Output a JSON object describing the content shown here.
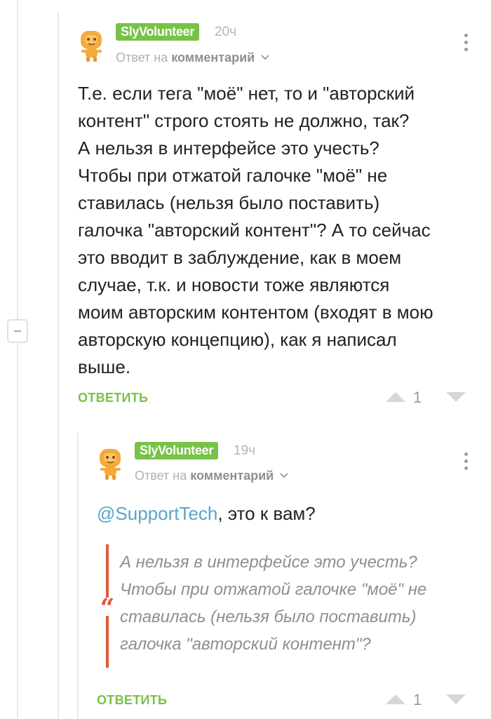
{
  "comments": [
    {
      "username": "SlyVolunteer",
      "time": "20ч",
      "reply_prefix": "Ответ на",
      "reply_target": "комментарий",
      "text_lines": [
        "Т.е. если тега \"моё\" нет, то и \"авторский",
        "контент\" строго стоять не должно, так?",
        "А нельзя в интерфейсе это учесть?",
        "Чтобы при отжатой галочке \"моё\" не",
        "ставилась (нельзя было поставить)",
        "галочка \"авторский контент\"? А то сейчас",
        "это вводит в заблуждение, как в моем",
        "случае, т.к. и новости тоже являются",
        "моим авторским контентом (входят в мою",
        "авторскую концепцию), как я написал",
        "выше."
      ],
      "reply_label": "ОТВЕТИТЬ",
      "score": "1"
    },
    {
      "username": "SlyVolunteer",
      "time": "19ч",
      "reply_prefix": "Ответ на",
      "reply_target": "комментарий",
      "mention": "@SupportTech",
      "text_after_mention": ", это к вам?",
      "quote_lines": [
        "А нельзя в интерфейсе это учесть?",
        "Чтобы при отжатой галочке \"моё\" не",
        "ставилась (нельзя было поставить)",
        "галочка \"авторский контент\"?"
      ],
      "quote_mark": "“",
      "reply_label": "ОТВЕТИТЬ",
      "score": "1"
    }
  ],
  "colors": {
    "username_bg": "#78c248",
    "reply_button": "#78c248",
    "mention_link": "#5aa4c9",
    "quote_accent": "#e05a3a"
  },
  "icons": {
    "avatar": "orange-robot-avatar-icon",
    "more": "vertical-ellipsis-icon",
    "upvote": "triangle-up-icon",
    "downvote": "triangle-down-icon",
    "chevron": "chevron-down-icon",
    "collapse": "minus-icon"
  }
}
